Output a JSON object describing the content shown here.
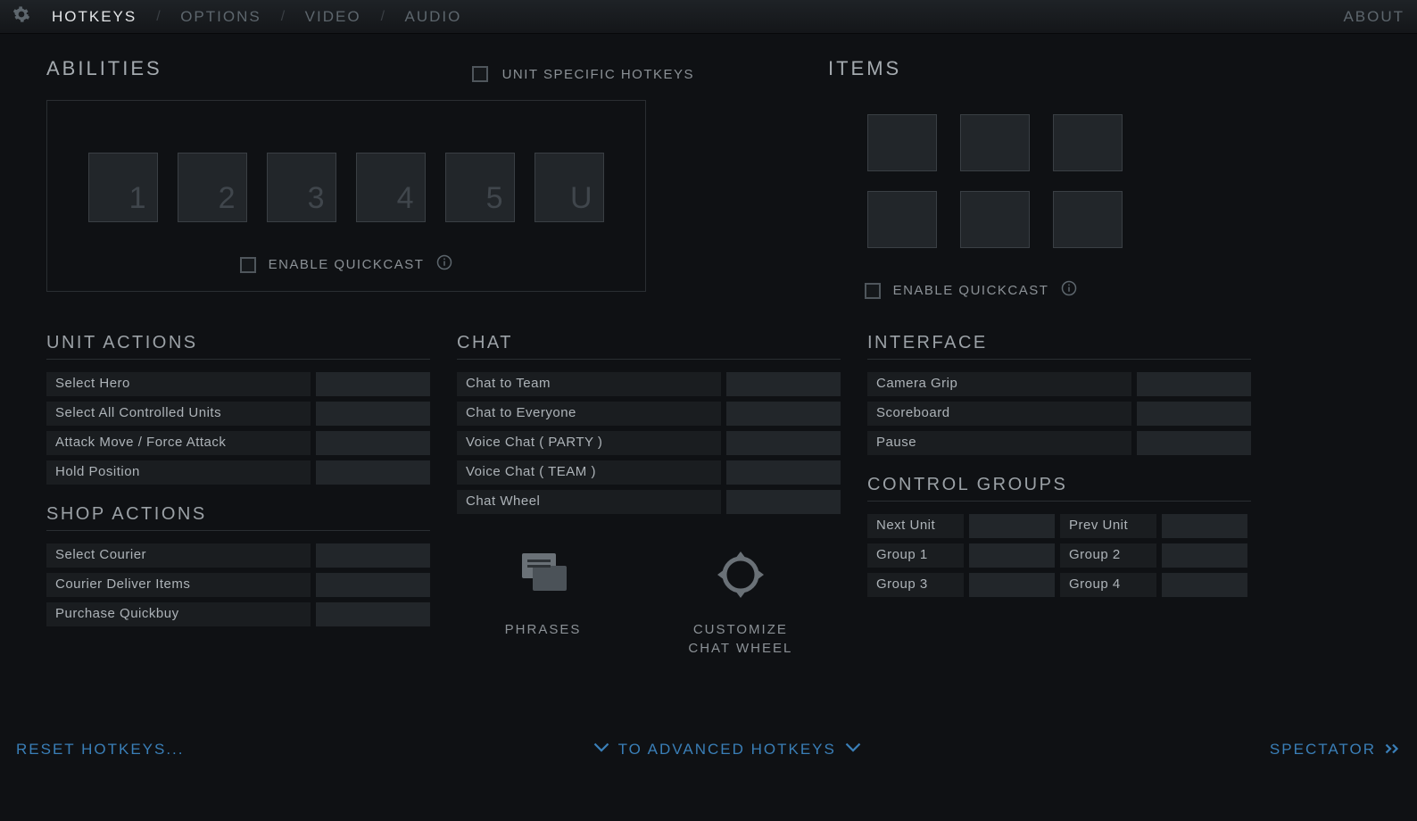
{
  "nav": {
    "hotkeys": "HOTKEYS",
    "options": "OPTIONS",
    "video": "VIDEO",
    "audio": "AUDIO",
    "about": "ABOUT"
  },
  "abilities": {
    "header": "ABILITIES",
    "unit_specific": "UNIT SPECIFIC HOTKEYS",
    "slots": [
      "1",
      "2",
      "3",
      "4",
      "5",
      "U"
    ],
    "enable_qc": "ENABLE QUICKCAST"
  },
  "items": {
    "header": "ITEMS",
    "enable_qc": "ENABLE QUICKCAST"
  },
  "unit_actions": {
    "header": "UNIT ACTIONS",
    "rows": [
      "Select Hero",
      "Select All Controlled Units",
      "Attack Move / Force Attack",
      "Hold Position"
    ]
  },
  "shop_actions": {
    "header": "SHOP ACTIONS",
    "rows": [
      "Select Courier",
      "Courier Deliver Items",
      "Purchase Quickbuy"
    ]
  },
  "chat": {
    "header": "CHAT",
    "rows": [
      "Chat to Team",
      "Chat to Everyone",
      "Voice Chat ( PARTY )",
      "Voice Chat ( TEAM )",
      "Chat Wheel"
    ],
    "phrases": "PHRASES",
    "customize1": "CUSTOMIZE",
    "customize2": "CHAT WHEEL"
  },
  "interface": {
    "header": "INTERFACE",
    "rows": [
      "Camera Grip",
      "Scoreboard",
      "Pause"
    ]
  },
  "control_groups": {
    "header": "CONTROL GROUPS",
    "rows": [
      [
        "Next Unit",
        "Prev Unit"
      ],
      [
        "Group 1",
        "Group 2"
      ],
      [
        "Group 3",
        "Group 4"
      ]
    ]
  },
  "bottom": {
    "reset": "RESET HOTKEYS...",
    "advanced": "TO ADVANCED HOTKEYS",
    "spectator": "SPECTATOR"
  }
}
